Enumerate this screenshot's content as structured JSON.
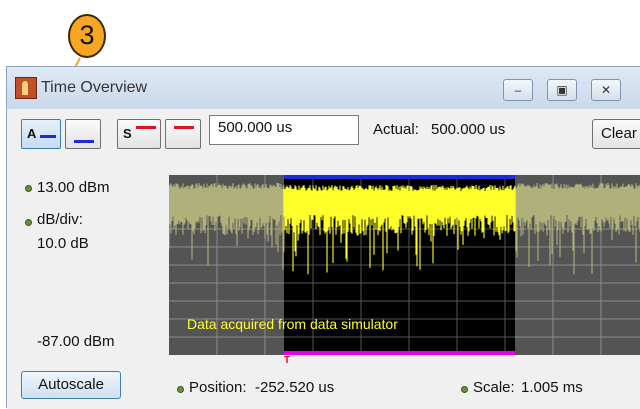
{
  "callout": {
    "number": "3"
  },
  "window": {
    "title": "Time Overview",
    "controls": {
      "minimize": "–",
      "maximize": "▣",
      "close": "✕"
    }
  },
  "toolbar": {
    "marker_a_label": "A",
    "marker_b_label": "",
    "marker_s_label": "S",
    "marker_e_label": "",
    "time_value": "500.000 us",
    "actual_label": "Actual:",
    "actual_value": "500.000 us",
    "clear_label": "Clear"
  },
  "left_panel": {
    "ref_level": "13.00 dBm",
    "scale_label": "dB/div:",
    "scale_value": "10.0 dB",
    "bottom_level": "-87.00 dBm",
    "autoscale_label": "Autoscale"
  },
  "plot": {
    "annotation": "Data acquired from data simulator",
    "trigger_marker": "T",
    "window_start_fraction": 0.24,
    "window_end_fraction": 0.72,
    "colors": {
      "outside_trace": "#8a8a3a",
      "inside_trace": "#ffff2a",
      "top_bar": "#1f2bd6",
      "bottom_bar": "#e600e6",
      "grid": "#555555",
      "annotation": "#ffff2a"
    }
  },
  "bottom": {
    "position_label": "Position:",
    "position_value": "-252.520 us",
    "scale_label": "Scale:",
    "scale_value": "1.005 ms"
  },
  "colors": {
    "callout_fill": "#f5a623",
    "marker_blue": "#1f2bd6",
    "marker_red": "#e0141e"
  }
}
